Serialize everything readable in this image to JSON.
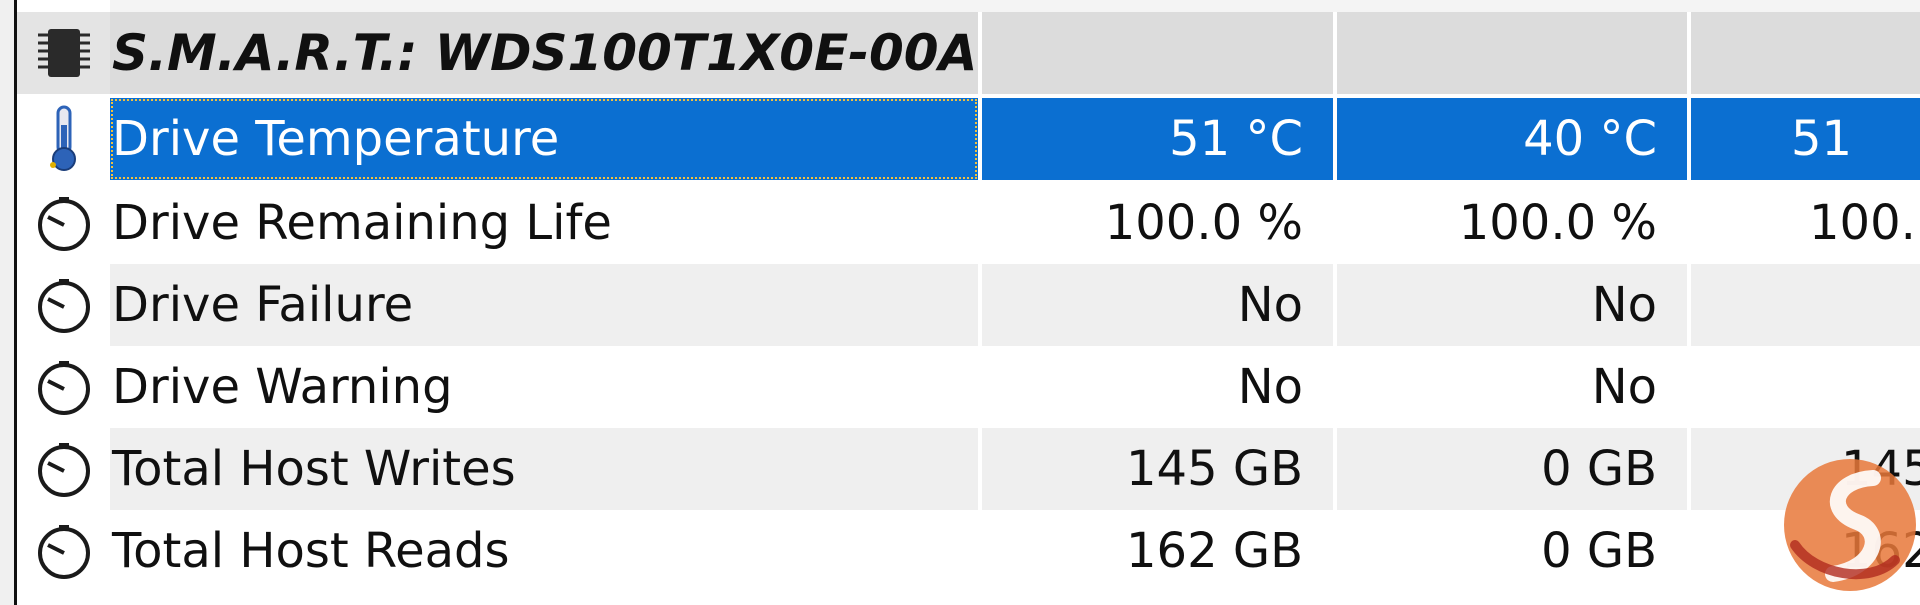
{
  "colors": {
    "selection": "#0b6fd1",
    "header_bg": "#dcdcdc",
    "alt_row": "#efefef"
  },
  "header": {
    "title": "S.M.A.R.T.: WDS100T1X0E-00A...",
    "icon": "chip-icon"
  },
  "rows": [
    {
      "label": "Drive Temperature",
      "icon": "thermometer-icon",
      "values": [
        "51 °C",
        "40 °C",
        "51"
      ]
    },
    {
      "label": "Drive Remaining Life",
      "icon": "gauge-icon",
      "values": [
        "100.0 %",
        "100.0 %",
        "100.("
      ]
    },
    {
      "label": "Drive Failure",
      "icon": "gauge-icon",
      "values": [
        "No",
        "No",
        ""
      ]
    },
    {
      "label": "Drive Warning",
      "icon": "gauge-icon",
      "values": [
        "No",
        "No",
        ""
      ]
    },
    {
      "label": "Total Host Writes",
      "icon": "gauge-icon",
      "values": [
        "145 GB",
        "0 GB",
        "145"
      ]
    },
    {
      "label": "Total Host Reads",
      "icon": "gauge-icon",
      "values": [
        "162 GB",
        "0 GB",
        "162"
      ]
    }
  ]
}
